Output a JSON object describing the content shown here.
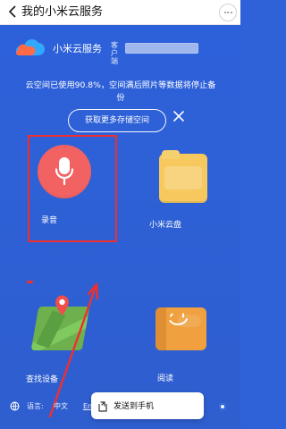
{
  "topbar": {
    "title": "我的小米云服务"
  },
  "brand": {
    "name": "小米云服务",
    "sub": "客户端"
  },
  "notice": {
    "text": "云空间已使用90.8%，空间满后照片等数据将停止备份",
    "button_label": "获取更多存储空间"
  },
  "items": [
    {
      "label": "录音",
      "icon": "microphone-icon"
    },
    {
      "label": "小米云盘",
      "icon": "folder-icon"
    },
    {
      "label": "查找设备",
      "icon": "map-pin-icon"
    },
    {
      "label": "阅读",
      "icon": "book-icon"
    }
  ],
  "footer": {
    "language_label": "语言:",
    "language_value": "中文",
    "language_link": "Eng",
    "send_to_phone": "发送到手机"
  },
  "colors": {
    "background": "#2f61d8",
    "recorder_circle": "#f26263",
    "folder": "#f6c85e",
    "map": "#6db04d",
    "book": "#f0a03e",
    "highlight": "#ef2f2f"
  }
}
